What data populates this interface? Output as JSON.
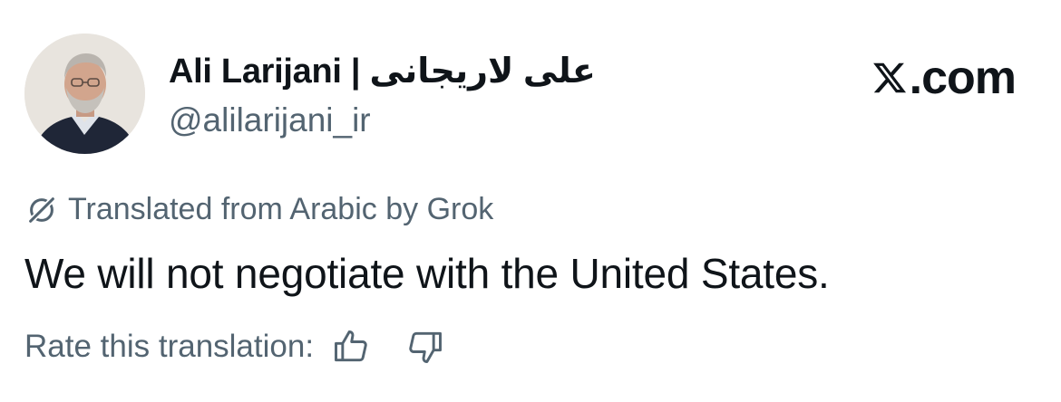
{
  "profile": {
    "display_name": "Ali Larijani | علی لاریجانی",
    "handle": "@alilarijani_ir",
    "avatar_icon": "profile-photo"
  },
  "brand": {
    "logo_icon": "x-logo-icon",
    "text": ".com"
  },
  "translation": {
    "icon": "grok-icon",
    "notice": "Translated from Arabic by Grok"
  },
  "tweet": {
    "text": "We will not negotiate with the United States."
  },
  "rating": {
    "label": "Rate this translation:",
    "up_icon": "thumbs-up-icon",
    "down_icon": "thumbs-down-icon"
  },
  "colors": {
    "primary_text": "#0f1419",
    "secondary_text": "#536471",
    "background": "#ffffff"
  }
}
